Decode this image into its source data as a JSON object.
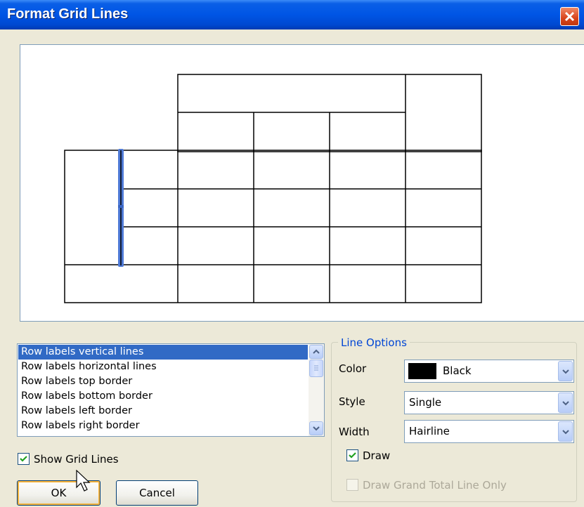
{
  "window": {
    "title": "Format Grid Lines"
  },
  "list": {
    "items": [
      {
        "label": "Row labels vertical lines",
        "selected": true
      },
      {
        "label": "Row labels horizontal lines",
        "selected": false
      },
      {
        "label": "Row labels top border",
        "selected": false
      },
      {
        "label": "Row labels bottom border",
        "selected": false
      },
      {
        "label": "Row labels left border",
        "selected": false
      },
      {
        "label": "Row labels right border",
        "selected": false
      }
    ]
  },
  "show_grid": {
    "label": "Show Grid Lines",
    "checked": true
  },
  "line_options": {
    "title": "Line Options",
    "color": {
      "label": "Color",
      "value": "Black",
      "swatch": "#000000"
    },
    "style": {
      "label": "Style",
      "value": "Single"
    },
    "width": {
      "label": "Width",
      "value": "Hairline"
    },
    "draw": {
      "label": "Draw",
      "checked": true
    },
    "grand_total": {
      "label": "Draw Grand Total Line Only",
      "checked": false,
      "enabled": false
    }
  },
  "buttons": {
    "ok": "OK",
    "cancel": "Cancel"
  },
  "colors": {
    "highlight": "#316ac5",
    "selected_line": "#4f7ad6",
    "group_title": "#0046d5"
  }
}
